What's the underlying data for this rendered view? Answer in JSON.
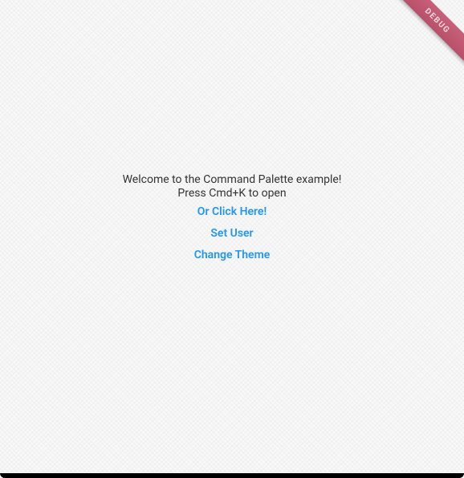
{
  "main": {
    "welcome_line1": "Welcome to the Command Palette example!",
    "welcome_line2": "Press Cmd+K to open",
    "buttons": {
      "click_here": "Or Click Here!",
      "set_user": "Set User",
      "change_theme": "Change Theme"
    }
  },
  "debug_banner": {
    "label": "DEBUG"
  },
  "colors": {
    "link": "#2196F3",
    "text": "#333333",
    "ribbon": "#b8506a"
  }
}
